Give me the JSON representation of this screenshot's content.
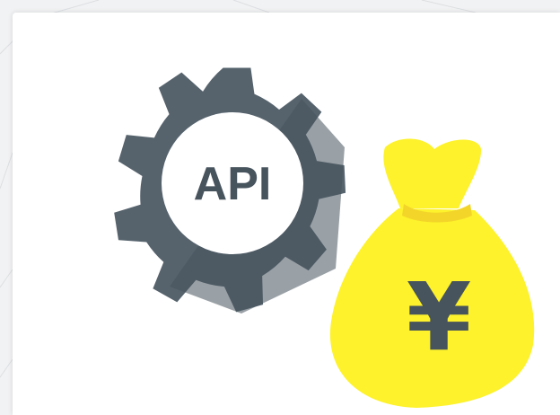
{
  "card": {
    "api_badge_text": "API",
    "currency_symbol": "¥"
  },
  "colors": {
    "gear_body": "#56636d",
    "gear_shadow": "#47535d",
    "gear_center": "#ffffff",
    "api_text": "#47535d",
    "money_bag": "#fdf22b",
    "money_bag_tie": "#f3d52a",
    "currency_symbol": "#47535d",
    "card_background": "#ffffff",
    "page_background": "#f1f2f3"
  },
  "icons": {
    "gear": "gear-icon",
    "money_bag": "money-bag-icon"
  }
}
